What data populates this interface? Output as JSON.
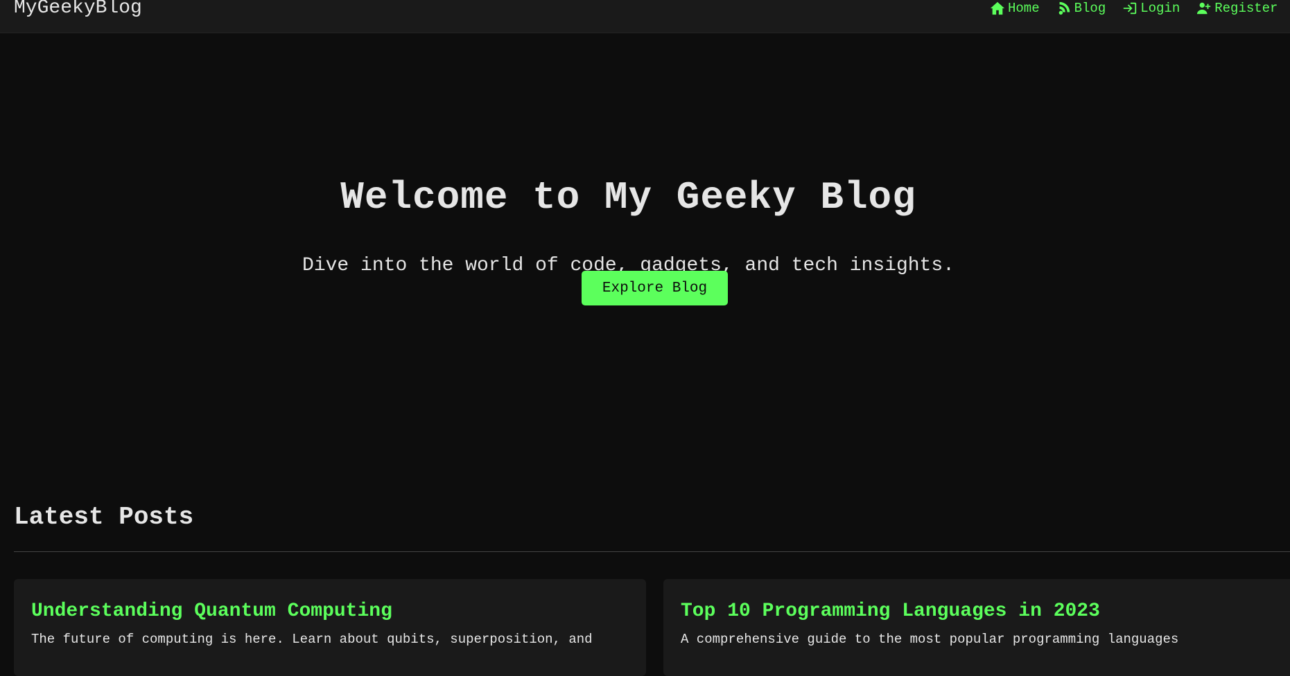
{
  "navbar": {
    "brand": "MyGeekyBlog",
    "links": [
      {
        "label": "Home",
        "icon": "home-icon"
      },
      {
        "label": "Blog",
        "icon": "blog-icon"
      },
      {
        "label": "Login",
        "icon": "login-icon"
      },
      {
        "label": "Register",
        "icon": "user-plus-icon"
      }
    ]
  },
  "hero": {
    "title": "Welcome to My Geeky Blog",
    "subtitle": "Dive into the world of code, gadgets, and tech insights.",
    "cta_label": "Explore Blog"
  },
  "latest": {
    "heading": "Latest Posts",
    "posts": [
      {
        "title": "Understanding Quantum Computing",
        "excerpt": "The future of computing is here. Learn about qubits, superposition, and"
      },
      {
        "title": "Top 10 Programming Languages in 2023",
        "excerpt": "A comprehensive guide to the most popular programming languages"
      }
    ]
  },
  "colors": {
    "background": "#0d0d0d",
    "navbar": "#1a1a1a",
    "accent": "#5cff5c",
    "text": "#e6e6e6"
  }
}
